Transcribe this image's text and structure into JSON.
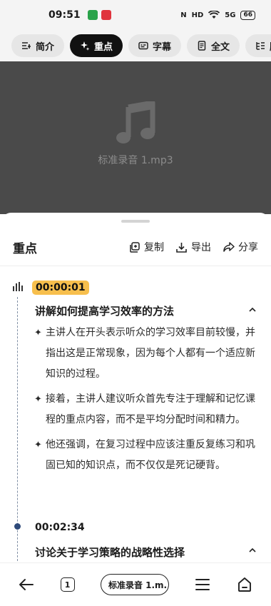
{
  "status_bar": {
    "time": "09:51",
    "battery": "66",
    "signal_label": "5G"
  },
  "tabs": [
    {
      "label": "简介",
      "icon": "intro-icon",
      "active": false
    },
    {
      "label": "重点",
      "icon": "sparkle-icon",
      "active": true
    },
    {
      "label": "字幕",
      "icon": "subtitle-icon",
      "active": false
    },
    {
      "label": "全文",
      "icon": "document-icon",
      "active": false
    },
    {
      "label": "脑图",
      "icon": "mindmap-icon",
      "active": false
    }
  ],
  "media": {
    "filename": "标准录音 1.mp3",
    "icon": "music-note-icon"
  },
  "sheet": {
    "title": "重点",
    "actions": {
      "copy": "复制",
      "export": "导出",
      "share": "分享"
    }
  },
  "sections": [
    {
      "timestamp": "00:00:01",
      "title": "讲解如何提高学习效率的方法",
      "bullets": [
        "主讲人在开头表示听众的学习效率目前较慢，并指出这是正常现象，因为每个人都有一个适应新知识的过程。",
        "接着，主讲人建议听众首先专注于理解和记忆课程的重点内容，而不是平均分配时间和精力。",
        "他还强调，在复习过程中应该注重反复练习和巩固已知的知识点，而不仅仅是死记硬背。"
      ]
    },
    {
      "timestamp": "00:02:34",
      "title": "讨论关于学习策略的战略性选择"
    }
  ],
  "navbar": {
    "tab_count": "1",
    "url_label": "标准录音 1.m..."
  },
  "colors": {
    "accent_timestamp": "#f7bf4d",
    "active_tab": "#111111",
    "media_bg": "#4a4a4a"
  }
}
